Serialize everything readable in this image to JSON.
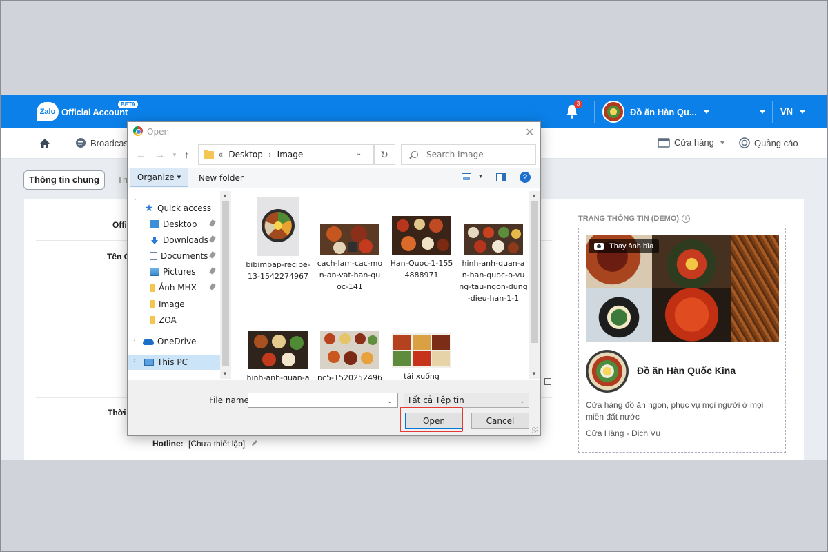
{
  "app": {
    "logo": "Zalo",
    "brand": "Official Account",
    "beta": "BETA",
    "notifications": "3",
    "account_name": "Đồ ăn Hàn Qu...",
    "language": "VN",
    "accent_color": "#0a80e8"
  },
  "nav": {
    "broadcast": "Broadcast",
    "store": "Cửa hàng",
    "ads": "Quảng cáo"
  },
  "tabs": {
    "general": "Thông tin chung",
    "other_partial": "Th"
  },
  "form": {
    "label_official": "Offic",
    "label_name": "Tên O",
    "label_time": "Thời g",
    "label_hotline": "Hotline:",
    "hotline_value": "[Chưa thiết lập]"
  },
  "preview": {
    "title": "TRANG THÔNG TIN (DEMO)",
    "change_cover": "Thay ảnh bìa",
    "shop_name": "Đồ ăn Hàn Quốc Kina",
    "description": "Cửa hàng đồ ăn ngon, phục vụ mọi người ở mọi miền đất nước",
    "category": "Cửa Hàng - Dịch Vụ"
  },
  "dialog": {
    "title": "Open",
    "path_prefix": "«",
    "path": [
      "Desktop",
      "Image"
    ],
    "search_placeholder": "Search Image",
    "organize": "Organize",
    "new_folder": "New folder",
    "help": "?",
    "nav_items": [
      {
        "label": "Quick access",
        "icon": "star-icon"
      },
      {
        "label": "Desktop",
        "icon": "desktop-icon",
        "pinned": true
      },
      {
        "label": "Downloads",
        "icon": "download-icon",
        "pinned": true
      },
      {
        "label": "Documents",
        "icon": "document-icon",
        "pinned": true
      },
      {
        "label": "Pictures",
        "icon": "pictures-icon",
        "pinned": true
      },
      {
        "label": "Ảnh MHX",
        "icon": "folder-icon",
        "pinned": true
      },
      {
        "label": "Image",
        "icon": "folder-icon"
      },
      {
        "label": "ZOA",
        "icon": "folder-icon"
      },
      {
        "label": "OneDrive",
        "icon": "onedrive-icon"
      },
      {
        "label": "This PC",
        "icon": "pc-icon",
        "selected": true
      }
    ],
    "files": [
      {
        "name_lines": [
          "bibimbap-recipe-",
          "13-1542274967"
        ]
      },
      {
        "name_lines": [
          "cach-lam-cac-mo",
          "n-an-vat-han-qu",
          "oc-141"
        ]
      },
      {
        "name_lines": [
          "Han-Quoc-1-155",
          "4888971"
        ]
      },
      {
        "name_lines": [
          "hinh-anh-quan-a",
          "n-han-quoc-o-vu",
          "ng-tau-ngon-dung",
          "-dieu-han-1-1"
        ]
      },
      {
        "name_lines": [
          "hinh-anh-quan-a"
        ]
      },
      {
        "name_lines": [
          "pc5-1520252496"
        ]
      },
      {
        "name_lines": [
          "tải xuống"
        ]
      }
    ],
    "file_name_label": "File name:",
    "file_name_value": "",
    "file_type": "Tất cả Tệp tin",
    "open": "Open",
    "cancel": "Cancel"
  }
}
